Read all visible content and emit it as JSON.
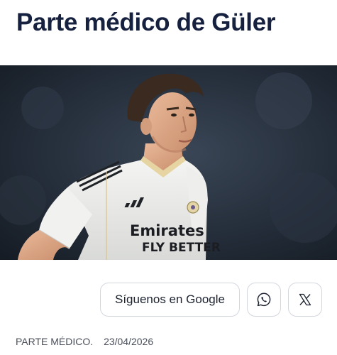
{
  "article": {
    "title": "Parte médico de Güler",
    "hero_image_icon": "player-photo",
    "jersey_sponsor_line1": "Emirates",
    "jersey_sponsor_line2": "FLY BETTER",
    "category": "PARTE MÉDICO.",
    "date": "23/04/2026"
  },
  "share": {
    "google_label": "Síguenos en Google",
    "whatsapp_icon": "whatsapp-icon",
    "x_icon": "x-icon"
  },
  "colors": {
    "title": "#16213f",
    "border": "#d3d7de",
    "meta_text": "#4a4f5a"
  }
}
